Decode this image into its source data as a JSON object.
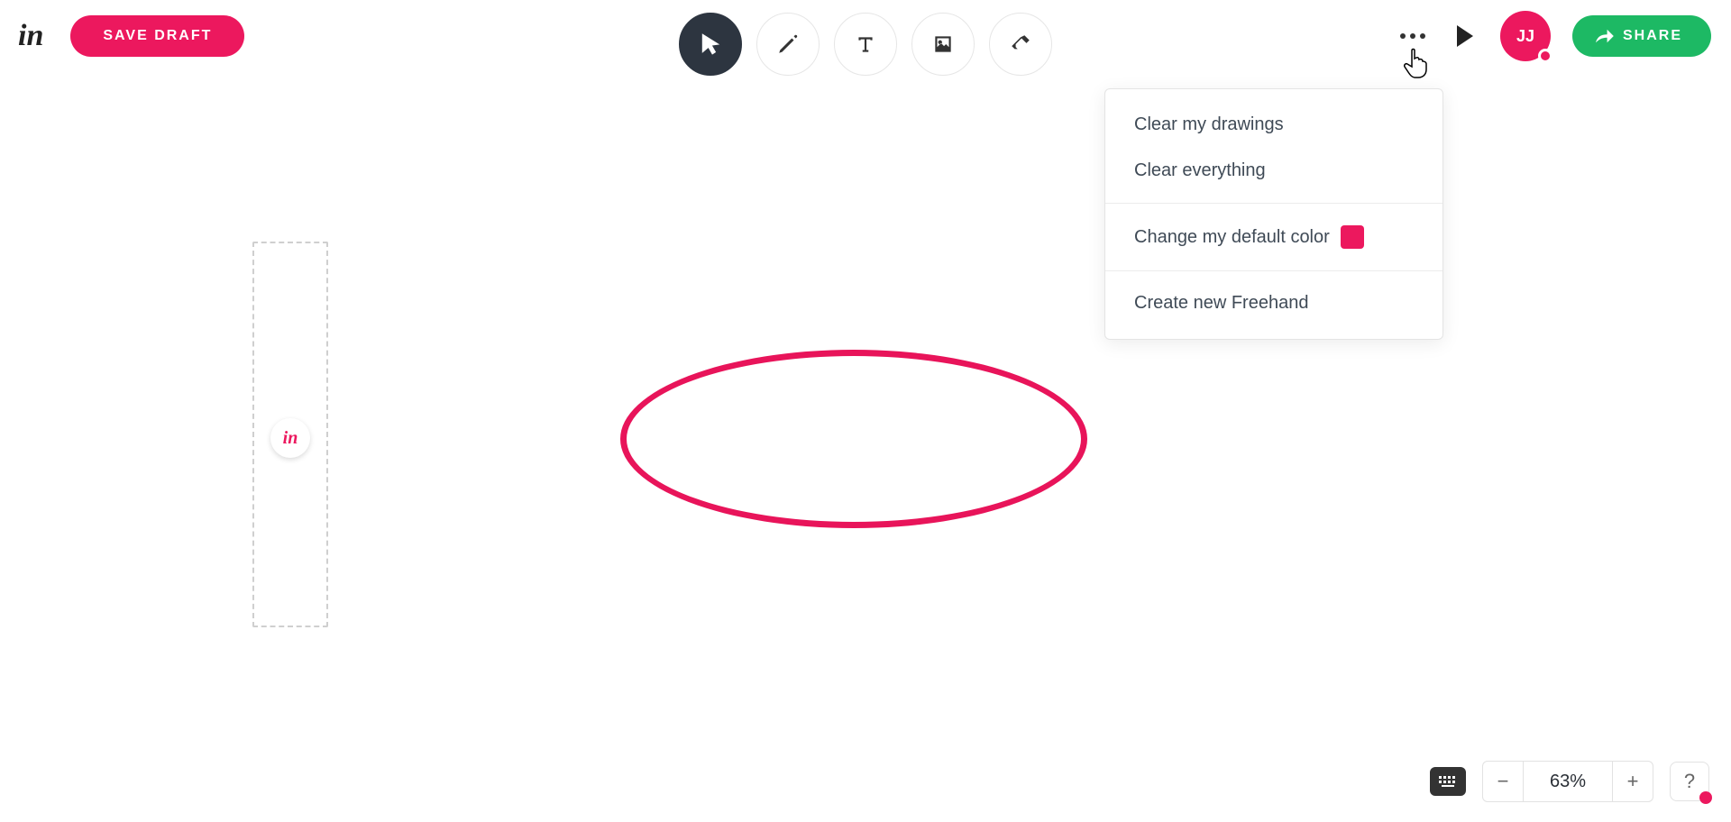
{
  "header": {
    "logo_text": "in",
    "save_label": "SAVE DRAFT",
    "share_label": "SHARE",
    "avatar_initials": "JJ"
  },
  "tools": {
    "pointer": "pointer-tool",
    "pencil": "pencil-tool",
    "text": "text-tool",
    "image": "image-tool",
    "eraser": "eraser-tool"
  },
  "menu": {
    "clear_my": "Clear my drawings",
    "clear_all": "Clear everything",
    "change_color": "Change my default color",
    "default_color": "#ec185e",
    "create_new": "Create new Freehand"
  },
  "zoom": {
    "value": "63%",
    "minus": "−",
    "plus": "+"
  },
  "help": {
    "label": "?"
  },
  "canvas": {
    "loader_text": "in"
  }
}
